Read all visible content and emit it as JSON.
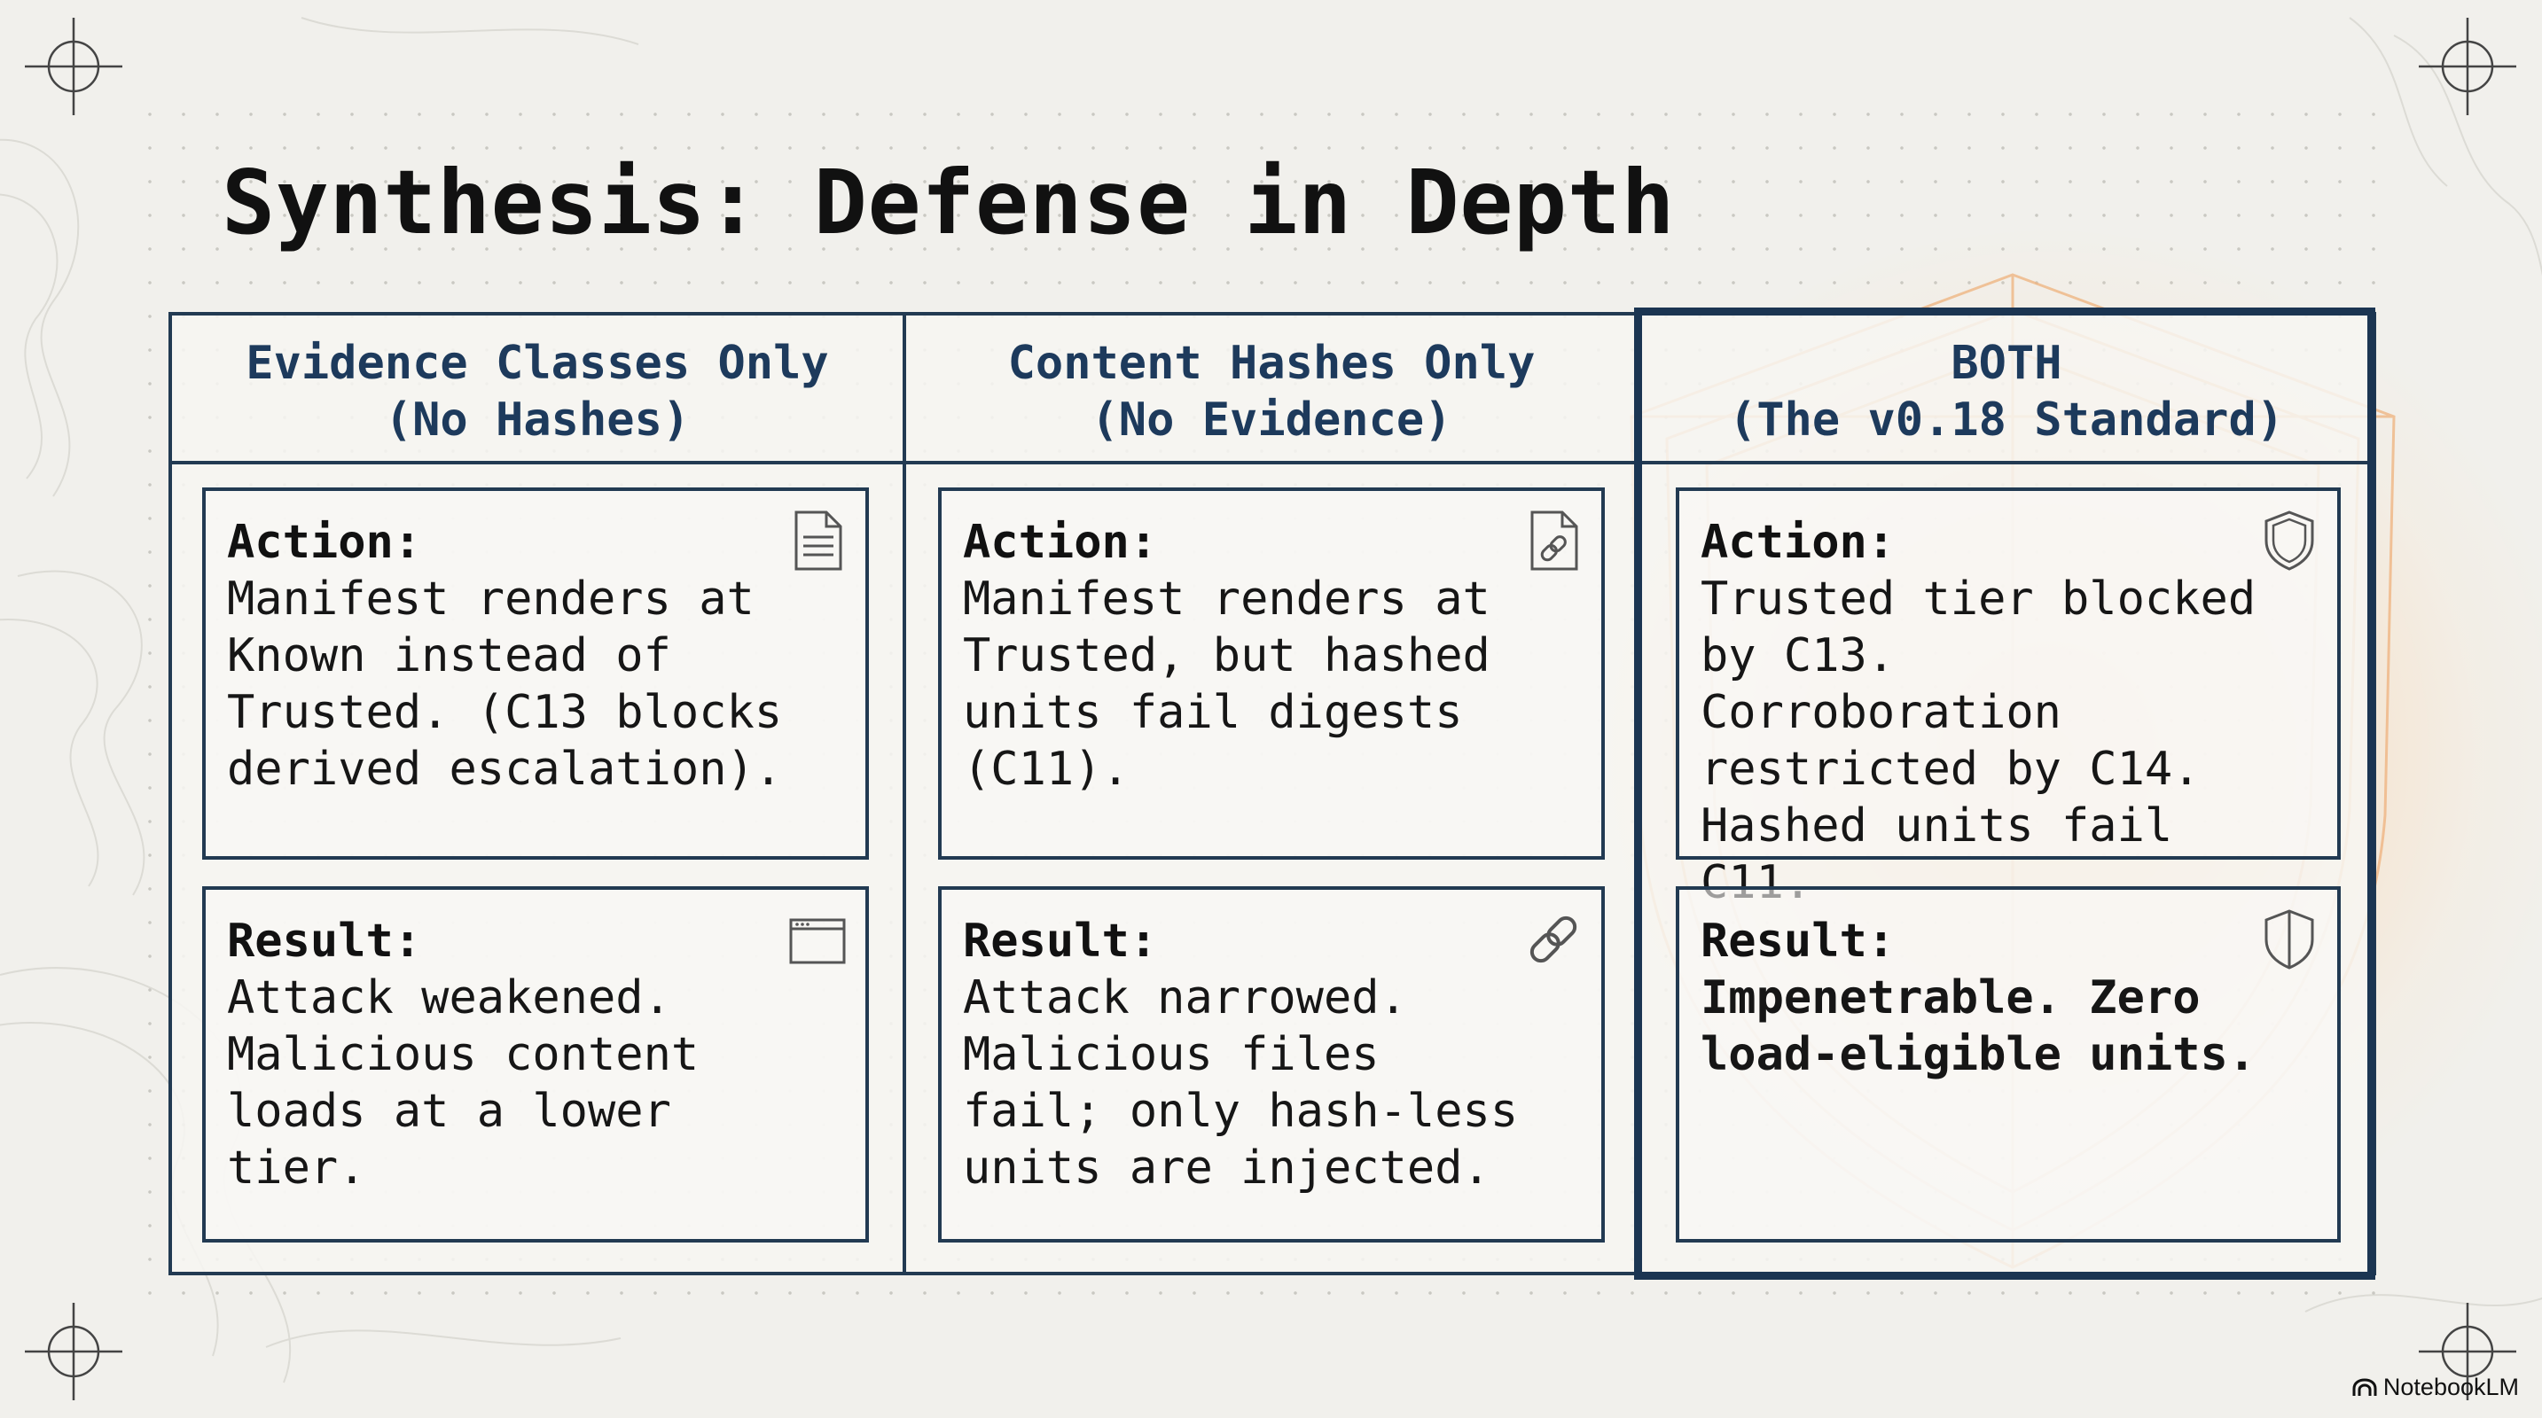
{
  "slide": {
    "title": "Synthesis: Defense in Depth"
  },
  "columns": [
    {
      "header_line1": "Evidence Classes Only",
      "header_line2": "(No Hashes)",
      "action_label": "Action:",
      "action_text": "Manifest renders at Known instead of Trusted. (C13 blocks derived escalation).",
      "action_icon": "document-icon",
      "result_label": "Result:",
      "result_text": "Attack weakened. Malicious content loads at a lower tier.",
      "result_icon": "window-icon"
    },
    {
      "header_line1": "Content Hashes Only",
      "header_line2": "(No Evidence)",
      "action_label": "Action:",
      "action_text": "Manifest renders at Trusted, but hashed units fail digests (C11).",
      "action_icon": "document-link-icon",
      "result_label": "Result:",
      "result_text": "Attack narrowed. Malicious files fail; only hash-less units are injected.",
      "result_icon": "chain-link-icon"
    },
    {
      "header_line1": "BOTH",
      "header_line2": "(The v0.18 Standard)",
      "action_label": "Action:",
      "action_text": "Trusted tier blocked by C13. Corroboration restricted by C14. Hashed units fail C11.",
      "action_icon": "shield-icon",
      "result_label": "Result:",
      "result_text": "Impenetrable. Zero load-eligible units.",
      "result_icon": "shield-half-icon"
    }
  ],
  "brand": {
    "name": "NotebookLM"
  },
  "colors": {
    "background": "#f1f0ec",
    "frame": "#223a52",
    "header_text": "#1d3a5c",
    "highlight_frame": "#1b3552",
    "glow": "#ffb76e"
  }
}
